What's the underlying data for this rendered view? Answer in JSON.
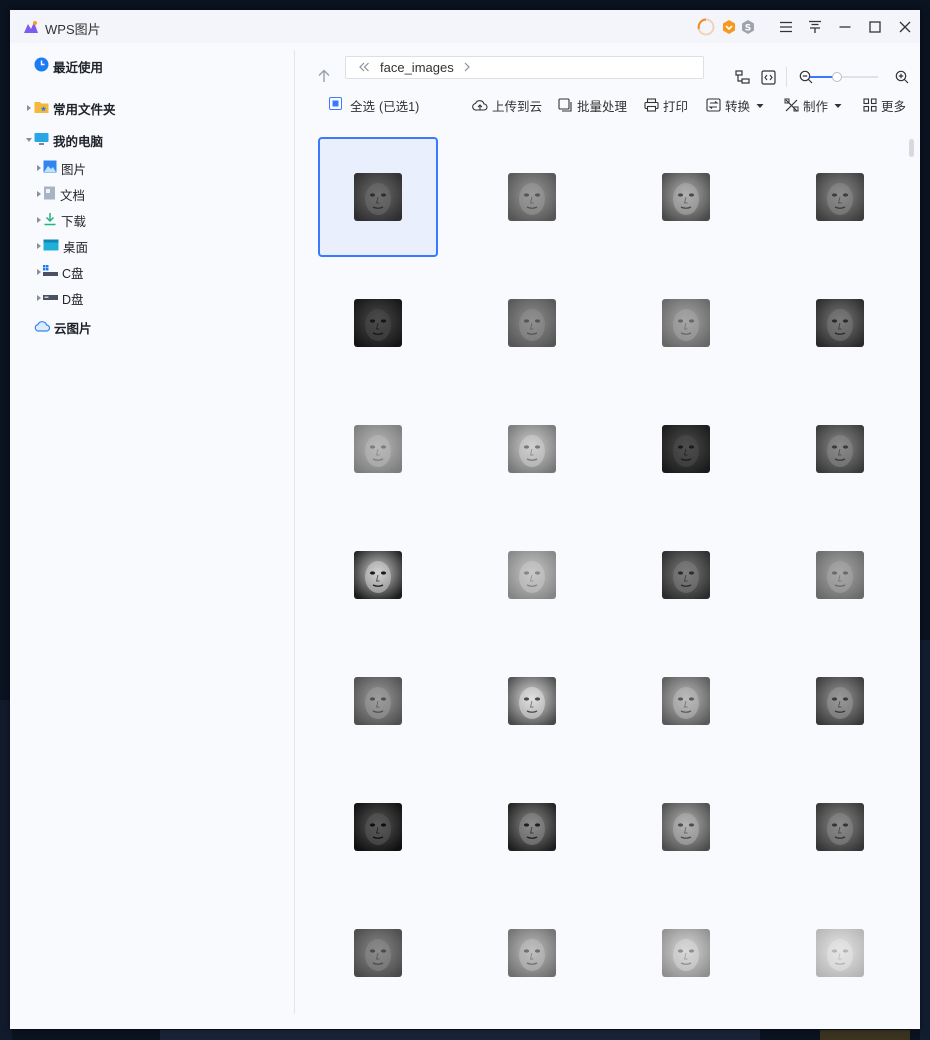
{
  "window": {
    "app_title": "WPS图片"
  },
  "sidebar": {
    "recent": "最近使用",
    "favorites": "常用文件夹",
    "my_computer": "我的电脑",
    "computer_children": [
      "图片",
      "文档",
      "下载",
      "桌面",
      "C盘",
      "D盘"
    ],
    "cloud": "云图片"
  },
  "pathbar": {
    "folder": "face_images"
  },
  "toolbar": {
    "select_all": "全选",
    "selected_count": "(已选1)",
    "upload": "上传到云",
    "batch": "批量处理",
    "print": "打印",
    "convert": "转换",
    "make": "制作",
    "more": "更多"
  },
  "colors": {
    "accent": "#3a7afe",
    "selection_bg": "#e9effd",
    "window_bg": "#f9fafd",
    "titlebar_bg": "#f3f5fa"
  },
  "thumbnails": {
    "count": 28,
    "columns": 4,
    "selected_index": 0,
    "tones": [
      [
        "#6d6d6d",
        "#2e2e2e"
      ],
      [
        "#9a9a9a",
        "#555555"
      ],
      [
        "#b0b0b0",
        "#4a4a4a"
      ],
      [
        "#8c8c8c",
        "#3d3d3d"
      ],
      [
        "#4a4a4a",
        "#151515"
      ],
      [
        "#8f8f8f",
        "#565656"
      ],
      [
        "#a5a5a5",
        "#676767"
      ],
      [
        "#7a7a7a",
        "#2a2a2a"
      ],
      [
        "#b9b9b9",
        "#7d7d7d"
      ],
      [
        "#cfcfcf",
        "#777777"
      ],
      [
        "#4d4d4d",
        "#1a1a1a"
      ],
      [
        "#8a8a8a",
        "#3a3a3a"
      ],
      [
        "#d2d2d2",
        "#1c1c1c"
      ],
      [
        "#c8c8c8",
        "#858585"
      ],
      [
        "#7d7d7d",
        "#2c2c2c"
      ],
      [
        "#a8a8a8",
        "#6a6a6a"
      ],
      [
        "#9d9d9d",
        "#505050"
      ],
      [
        "#e0e0e0",
        "#4a4a4a"
      ],
      [
        "#bbbbbb",
        "#5a5a5a"
      ],
      [
        "#999999",
        "#3a3a3a"
      ],
      [
        "#5a5a5a",
        "#0f0f0f"
      ],
      [
        "#8d8d8d",
        "#1e1e1e"
      ],
      [
        "#b3b3b3",
        "#4d4d4d"
      ],
      [
        "#8a8a8a",
        "#353535"
      ],
      [
        "#8a8a8a",
        "#4a4a4a"
      ],
      [
        "#c0c0c0",
        "#6f6f6f"
      ],
      [
        "#d8d8d8",
        "#8f8f8f"
      ],
      [
        "#e6e6e6",
        "#b5b5b5"
      ]
    ]
  },
  "icons": [
    "app-logo-icon",
    "loading-ring-icon",
    "vip-badge-icon",
    "s-badge-icon",
    "menu-icon",
    "pin-icon",
    "minimize-icon",
    "maximize-icon",
    "close-icon",
    "clock-icon",
    "folder-star-icon",
    "monitor-icon",
    "picture-icon",
    "document-icon",
    "download-icon",
    "desktop-icon",
    "drive-c-icon",
    "drive-d-icon",
    "cloud-icon",
    "up-arrow-icon",
    "double-chevron-left-icon",
    "chevron-right-icon",
    "tree-view-icon",
    "code-view-icon",
    "zoom-out-icon",
    "zoom-in-icon",
    "checkbox-icon",
    "cloud-upload-icon",
    "batch-icon",
    "print-icon",
    "convert-icon",
    "make-icon",
    "grid-more-icon"
  ]
}
